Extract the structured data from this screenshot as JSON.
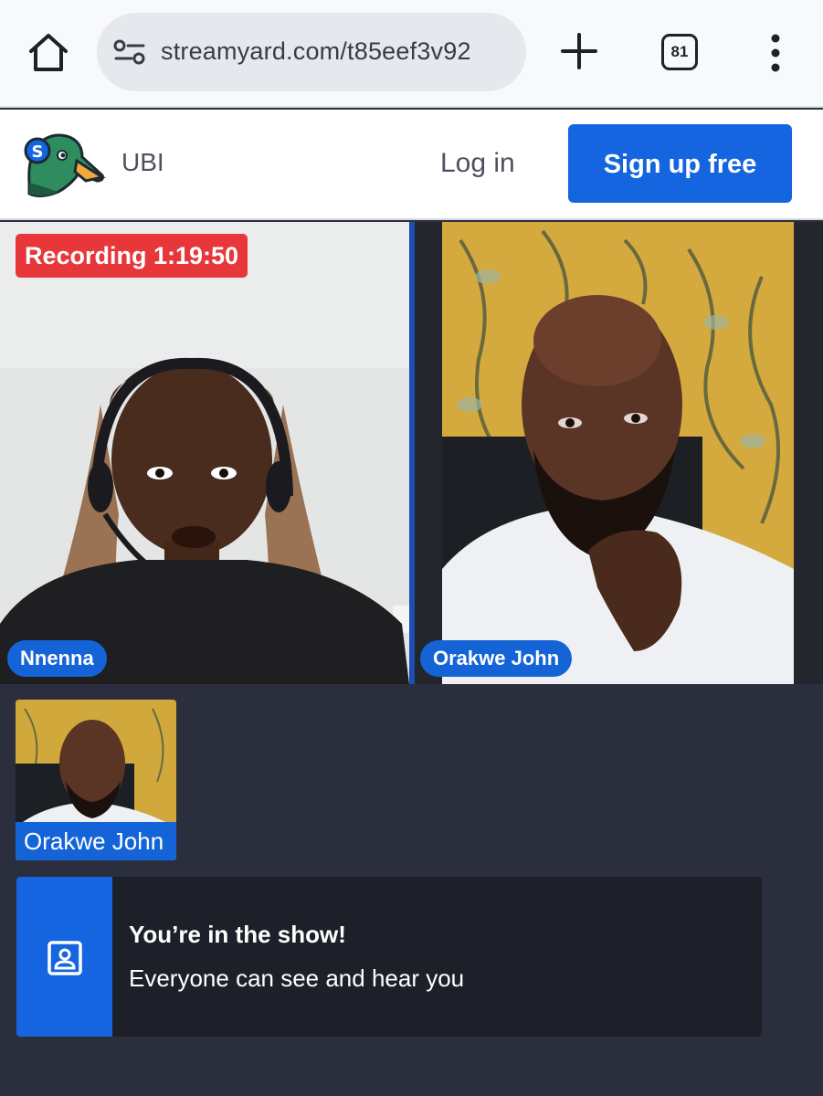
{
  "browser": {
    "url": "streamyard.com/t85eef3v92",
    "tab_count": "81",
    "icons": [
      "home-icon",
      "site-info-icon",
      "plus-icon",
      "tab-switcher-icon",
      "more-vert-icon"
    ]
  },
  "site_header": {
    "studio_name": "UBI",
    "login_label": "Log in",
    "signup_label": "Sign up free",
    "logo_letter": "S"
  },
  "stage": {
    "recording_label": "Recording 1:19:50",
    "participants": [
      {
        "name": "Nnenna"
      },
      {
        "name": "Orakwe John"
      }
    ]
  },
  "backstage": {
    "thumb_name": "Orakwe John"
  },
  "toast": {
    "title": "You’re in the show!",
    "message": "Everyone can see and hear you",
    "icon": "contact-card-icon"
  },
  "colors": {
    "accent": "#1565e0",
    "recording": "#e8373a",
    "name_tag": "#1464d8",
    "background": "#2b2e3d"
  }
}
